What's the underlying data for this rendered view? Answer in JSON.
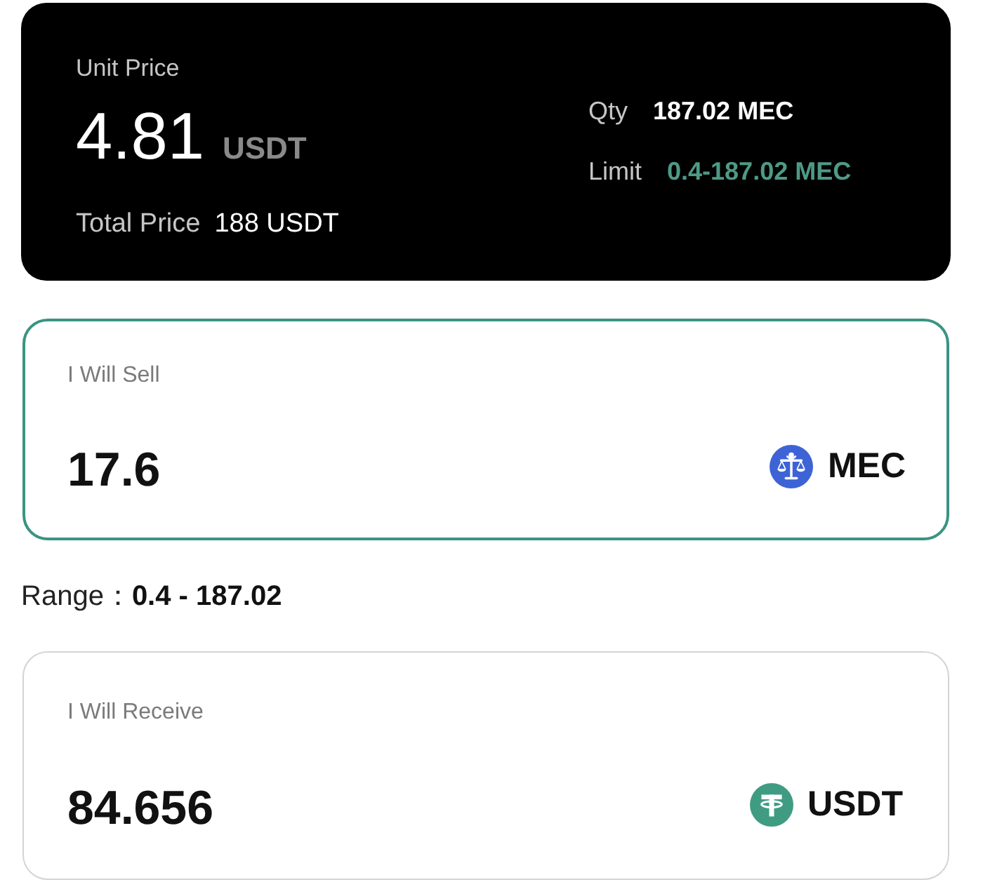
{
  "summary": {
    "unit_price_label": "Unit Price",
    "unit_price": "4.81",
    "unit_price_currency": "USDT",
    "total_price_label": "Total Price",
    "total_price": "188 USDT",
    "qty_label": "Qty",
    "qty": "187.02 MEC",
    "limit_label": "Limit",
    "limit": "0.4-187.02 MEC"
  },
  "sell": {
    "label": "I Will Sell",
    "value": "17.6",
    "currency": "MEC",
    "focused": true
  },
  "range": {
    "label": "Range：",
    "value": "0.4 - 187.02"
  },
  "receive": {
    "label": "I Will Receive",
    "value": "84.656",
    "currency": "USDT",
    "focused": false
  }
}
